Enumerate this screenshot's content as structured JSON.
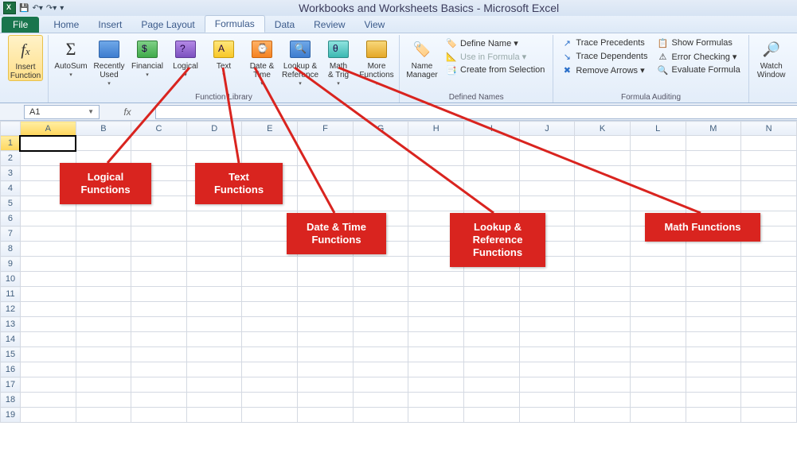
{
  "titlebar": {
    "title": "Workbooks and Worksheets Basics - Microsoft Excel"
  },
  "tabs": {
    "file": "File",
    "items": [
      "Home",
      "Insert",
      "Page Layout",
      "Formulas",
      "Data",
      "Review",
      "View"
    ],
    "active": "Formulas"
  },
  "ribbon": {
    "insert_function": "Insert\nFunction",
    "library": {
      "label": "Function Library",
      "buttons": [
        {
          "label": "AutoSum",
          "drop": true,
          "glyph": "Σ"
        },
        {
          "label": "Recently Used",
          "drop": true,
          "color": "blue",
          "glyph": ""
        },
        {
          "label": "Financial",
          "drop": true,
          "color": "green",
          "glyph": "$"
        },
        {
          "label": "Logical",
          "drop": true,
          "color": "purple",
          "glyph": "?"
        },
        {
          "label": "Text",
          "drop": true,
          "color": "yellow",
          "glyph": "A"
        },
        {
          "label": "Date & Time",
          "drop": true,
          "color": "orange",
          "glyph": "⌚"
        },
        {
          "label": "Lookup & Reference",
          "drop": true,
          "color": "blue",
          "glyph": "🔍"
        },
        {
          "label": "Math & Trig",
          "drop": true,
          "color": "teal",
          "glyph": "θ"
        },
        {
          "label": "More Functions",
          "drop": true,
          "color": "gold",
          "glyph": ""
        }
      ]
    },
    "defined_names": {
      "label": "Defined Names",
      "manager": "Name\nManager",
      "items": [
        "Define Name",
        "Use in Formula",
        "Create from Selection"
      ]
    },
    "auditing": {
      "label": "Formula Auditing",
      "left": [
        "Trace Precedents",
        "Trace Dependents",
        "Remove Arrows"
      ],
      "right": [
        "Show Formulas",
        "Error Checking",
        "Evaluate Formula"
      ]
    },
    "watch": "Watch\nWindow"
  },
  "formula_bar": {
    "cell_ref": "A1",
    "fx": "fx"
  },
  "grid": {
    "cols": [
      "A",
      "B",
      "C",
      "D",
      "E",
      "F",
      "G",
      "H",
      "I",
      "J",
      "K",
      "L",
      "M",
      "N"
    ],
    "rows": 19
  },
  "callouts": {
    "logical": "Logical Functions",
    "text": "Text Functions",
    "datetime": "Date & Time Functions",
    "lookup": "Lookup & Reference Functions",
    "math": "Math Functions"
  }
}
